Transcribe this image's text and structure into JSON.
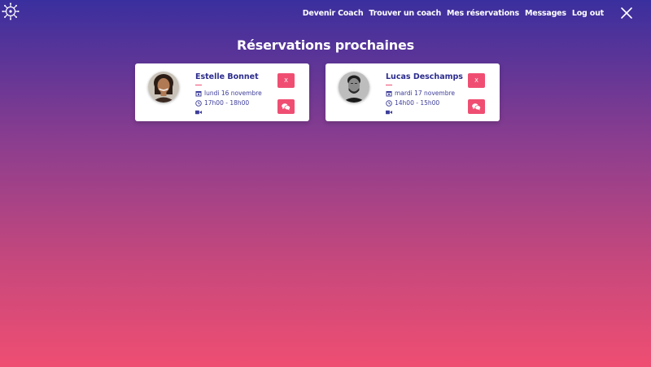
{
  "nav": {
    "links": [
      "Devenir Coach",
      "Trouver un coach",
      "Mes réservations",
      "Messages",
      "Log out"
    ]
  },
  "page": {
    "title": "Réservations prochaines"
  },
  "reservations": [
    {
      "coach_name": "Estelle Bonnet",
      "date": "lundi 16 novembre",
      "time": "17h00 - 18h00",
      "cancel_label": "X"
    },
    {
      "coach_name": "Lucas Deschamps",
      "date": "mardi 17 novembre",
      "time": "14h00 - 15h00",
      "cancel_label": "X"
    }
  ],
  "icons": {
    "logo": "compass-logo-icon",
    "close": "close-icon",
    "date": "calendar-icon",
    "time": "clock-icon",
    "video": "video-camera-icon",
    "chat": "chat-bubbles-icon"
  },
  "colors": {
    "gradient_top": "#3a2f9e",
    "gradient_bottom": "#ef4e72",
    "accent": "#ef4e72",
    "name": "#2c2c8e"
  }
}
